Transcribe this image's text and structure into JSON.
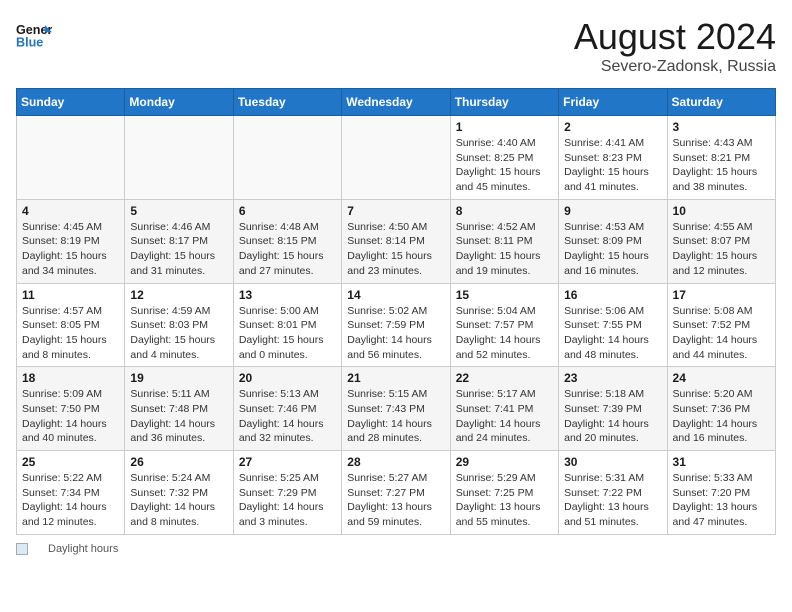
{
  "header": {
    "logo_general": "General",
    "logo_blue": "Blue",
    "title": "August 2024",
    "subtitle": "Severo-Zadonsk, Russia"
  },
  "days_of_week": [
    "Sunday",
    "Monday",
    "Tuesday",
    "Wednesday",
    "Thursday",
    "Friday",
    "Saturday"
  ],
  "weeks": [
    [
      {
        "num": "",
        "info": ""
      },
      {
        "num": "",
        "info": ""
      },
      {
        "num": "",
        "info": ""
      },
      {
        "num": "",
        "info": ""
      },
      {
        "num": "1",
        "info": "Sunrise: 4:40 AM\nSunset: 8:25 PM\nDaylight: 15 hours and 45 minutes."
      },
      {
        "num": "2",
        "info": "Sunrise: 4:41 AM\nSunset: 8:23 PM\nDaylight: 15 hours and 41 minutes."
      },
      {
        "num": "3",
        "info": "Sunrise: 4:43 AM\nSunset: 8:21 PM\nDaylight: 15 hours and 38 minutes."
      }
    ],
    [
      {
        "num": "4",
        "info": "Sunrise: 4:45 AM\nSunset: 8:19 PM\nDaylight: 15 hours and 34 minutes."
      },
      {
        "num": "5",
        "info": "Sunrise: 4:46 AM\nSunset: 8:17 PM\nDaylight: 15 hours and 31 minutes."
      },
      {
        "num": "6",
        "info": "Sunrise: 4:48 AM\nSunset: 8:15 PM\nDaylight: 15 hours and 27 minutes."
      },
      {
        "num": "7",
        "info": "Sunrise: 4:50 AM\nSunset: 8:14 PM\nDaylight: 15 hours and 23 minutes."
      },
      {
        "num": "8",
        "info": "Sunrise: 4:52 AM\nSunset: 8:11 PM\nDaylight: 15 hours and 19 minutes."
      },
      {
        "num": "9",
        "info": "Sunrise: 4:53 AM\nSunset: 8:09 PM\nDaylight: 15 hours and 16 minutes."
      },
      {
        "num": "10",
        "info": "Sunrise: 4:55 AM\nSunset: 8:07 PM\nDaylight: 15 hours and 12 minutes."
      }
    ],
    [
      {
        "num": "11",
        "info": "Sunrise: 4:57 AM\nSunset: 8:05 PM\nDaylight: 15 hours and 8 minutes."
      },
      {
        "num": "12",
        "info": "Sunrise: 4:59 AM\nSunset: 8:03 PM\nDaylight: 15 hours and 4 minutes."
      },
      {
        "num": "13",
        "info": "Sunrise: 5:00 AM\nSunset: 8:01 PM\nDaylight: 15 hours and 0 minutes."
      },
      {
        "num": "14",
        "info": "Sunrise: 5:02 AM\nSunset: 7:59 PM\nDaylight: 14 hours and 56 minutes."
      },
      {
        "num": "15",
        "info": "Sunrise: 5:04 AM\nSunset: 7:57 PM\nDaylight: 14 hours and 52 minutes."
      },
      {
        "num": "16",
        "info": "Sunrise: 5:06 AM\nSunset: 7:55 PM\nDaylight: 14 hours and 48 minutes."
      },
      {
        "num": "17",
        "info": "Sunrise: 5:08 AM\nSunset: 7:52 PM\nDaylight: 14 hours and 44 minutes."
      }
    ],
    [
      {
        "num": "18",
        "info": "Sunrise: 5:09 AM\nSunset: 7:50 PM\nDaylight: 14 hours and 40 minutes."
      },
      {
        "num": "19",
        "info": "Sunrise: 5:11 AM\nSunset: 7:48 PM\nDaylight: 14 hours and 36 minutes."
      },
      {
        "num": "20",
        "info": "Sunrise: 5:13 AM\nSunset: 7:46 PM\nDaylight: 14 hours and 32 minutes."
      },
      {
        "num": "21",
        "info": "Sunrise: 5:15 AM\nSunset: 7:43 PM\nDaylight: 14 hours and 28 minutes."
      },
      {
        "num": "22",
        "info": "Sunrise: 5:17 AM\nSunset: 7:41 PM\nDaylight: 14 hours and 24 minutes."
      },
      {
        "num": "23",
        "info": "Sunrise: 5:18 AM\nSunset: 7:39 PM\nDaylight: 14 hours and 20 minutes."
      },
      {
        "num": "24",
        "info": "Sunrise: 5:20 AM\nSunset: 7:36 PM\nDaylight: 14 hours and 16 minutes."
      }
    ],
    [
      {
        "num": "25",
        "info": "Sunrise: 5:22 AM\nSunset: 7:34 PM\nDaylight: 14 hours and 12 minutes."
      },
      {
        "num": "26",
        "info": "Sunrise: 5:24 AM\nSunset: 7:32 PM\nDaylight: 14 hours and 8 minutes."
      },
      {
        "num": "27",
        "info": "Sunrise: 5:25 AM\nSunset: 7:29 PM\nDaylight: 14 hours and 3 minutes."
      },
      {
        "num": "28",
        "info": "Sunrise: 5:27 AM\nSunset: 7:27 PM\nDaylight: 13 hours and 59 minutes."
      },
      {
        "num": "29",
        "info": "Sunrise: 5:29 AM\nSunset: 7:25 PM\nDaylight: 13 hours and 55 minutes."
      },
      {
        "num": "30",
        "info": "Sunrise: 5:31 AM\nSunset: 7:22 PM\nDaylight: 13 hours and 51 minutes."
      },
      {
        "num": "31",
        "info": "Sunrise: 5:33 AM\nSunset: 7:20 PM\nDaylight: 13 hours and 47 minutes."
      }
    ]
  ],
  "footer": {
    "daylight_label": "Daylight hours"
  }
}
